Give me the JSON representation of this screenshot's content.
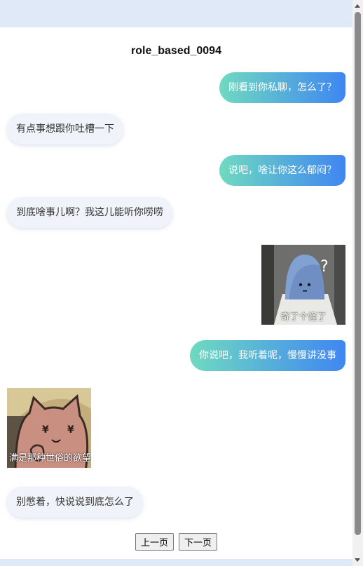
{
  "chat": {
    "title": "role_based_0094",
    "messages": [
      {
        "side": "sent",
        "text": "刚看到你私聊，怎么了？"
      },
      {
        "side": "received",
        "text": "有点事想跟你吐槽一下"
      },
      {
        "side": "sent",
        "text": "说吧，啥让你这么郁闷？"
      },
      {
        "side": "received",
        "text": "到底啥事儿啊？我这儿能听你唠唠"
      },
      {
        "side": "sent",
        "sticker": "blue-blob-question-sticker",
        "caption": "奇了个怪了"
      },
      {
        "side": "sent",
        "text": "你说吧，我听着呢，慢慢讲没事"
      },
      {
        "side": "received",
        "sticker": "yen-eyes-cat-sticker",
        "caption": "满是那种世俗的欲望"
      },
      {
        "side": "received",
        "text": "别憋着，快说说到底怎么了"
      }
    ]
  },
  "pager": {
    "prev_label": "上一页",
    "next_label": "下一页"
  },
  "colors": {
    "sent_gradient_start": "#6fdac0",
    "sent_gradient_end": "#3f86f2",
    "received_bg": "#f0f3f9"
  }
}
